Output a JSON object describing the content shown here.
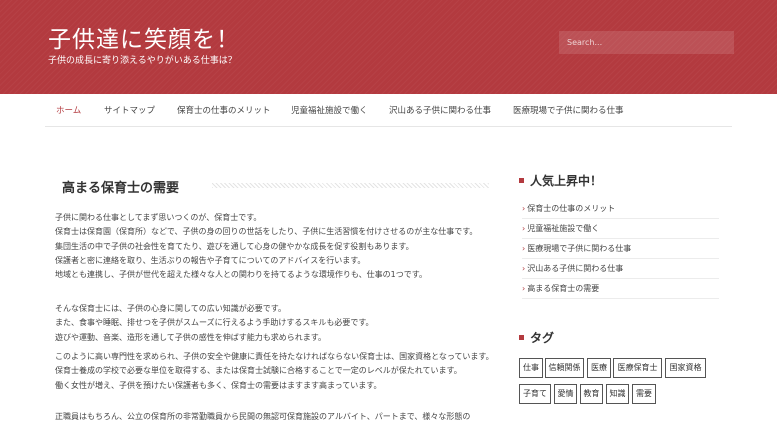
{
  "header": {
    "site_title": "子供達に笑顔を！",
    "site_description": "子供の成長に寄り添えるやりがいある仕事は？",
    "search_placeholder": "Search...",
    "brand_color": "#b33a3f"
  },
  "nav": {
    "items": [
      {
        "label": "ホーム",
        "active": true
      },
      {
        "label": "サイトマップ"
      },
      {
        "label": "保育士の仕事のメリット"
      },
      {
        "label": "児童福祉施設で働く"
      },
      {
        "label": "沢山ある子供に関わる仕事"
      },
      {
        "label": "医療現場で子供に関わる仕事"
      }
    ]
  },
  "main": {
    "title": "高まる保育士の需要",
    "paragraphs": [
      [
        "子供に関わる仕事としてまず思いつくのが、保育士です。",
        "保育士は保育園（保育所）などで、子供の身の回りの世話をしたり、子供に生活習慣を付けさせるのが主な仕事です。",
        "集団生活の中で子供の社会性を育てたり、遊びを通して心身の健やかな成長を促す役割もあります。",
        "保護者と密に連絡を取り、生活ぶりの報告や子育てについてのアドバイスを行います。",
        "地域とも連携し、子供が世代を超えた様々な人との関わりを持てるような環境作りも、仕事の1つです。"
      ],
      [
        "そんな保育士には、子供の心身に関しての広い知識が必要です。",
        "また、食事や睡眠、排せつを子供がスムーズに行えるよう手助けするスキルも必要です。",
        "遊びや運動、音楽、造形を通して子供の感性を伸ばす能力も求められます。"
      ],
      [
        "このように高い専門性を求められ、子供の安全や健康に責任を持たなければならない保育士は、国家資格となっています。",
        "保育士養成の学校で必要な単位を取得する、または保育士試験に合格することで一定のレベルが保たれています。",
        "働く女性が増え、子供を預けたい保護者も多く、保育士の需要はますます高まっています。"
      ],
      [
        "正職員はもちろん、公立の保育所の非常勤職員から民間の無認可保育施設のアルバイト、パートまで、様々な形態の"
      ]
    ]
  },
  "sidebar": {
    "popular_title": "人気上昇中！",
    "popular_items": [
      "保育士の仕事のメリット",
      "児童福祉施設で働く",
      "医療現場で子供に関わる仕事",
      "沢山ある子供に関わる仕事",
      "高まる保育士の需要"
    ],
    "tags_title": "タグ",
    "tags": [
      "仕事",
      "信頼関係",
      "医療",
      "医療保育士",
      "国家資格",
      "子育て",
      "愛情",
      "教育",
      "知識",
      "需要"
    ]
  }
}
